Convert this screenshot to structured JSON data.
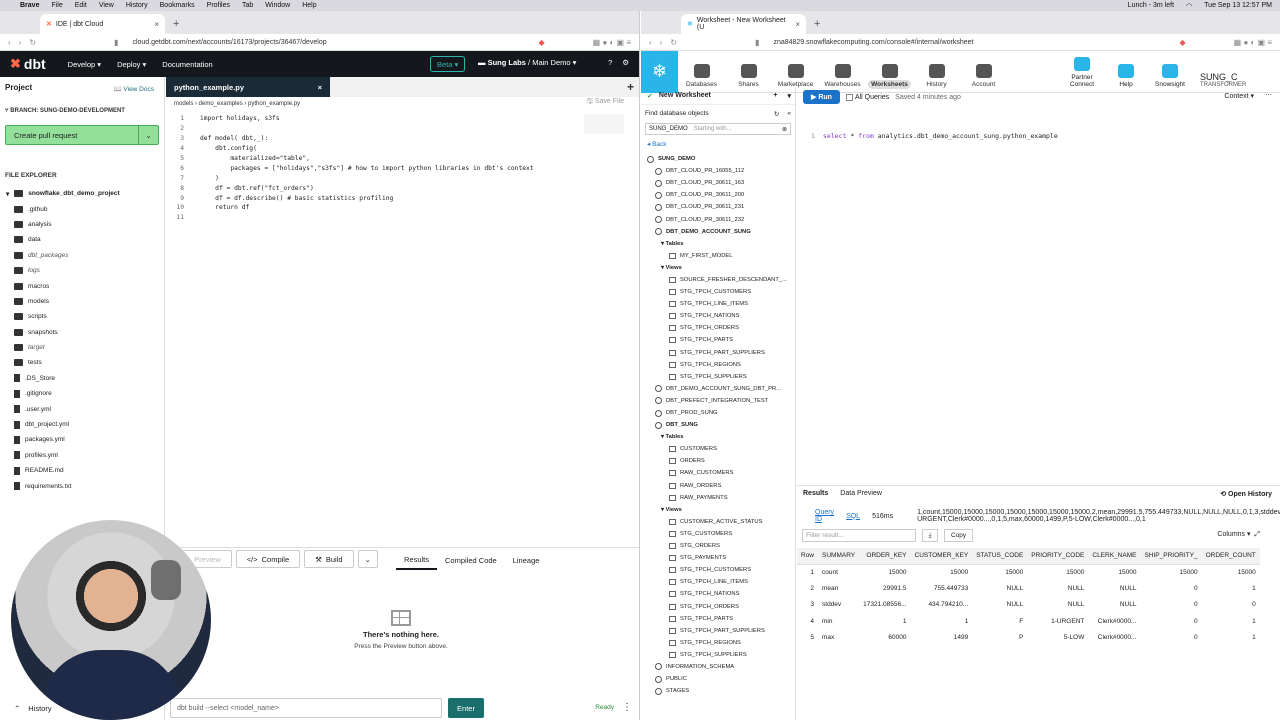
{
  "macbar": {
    "app": "Brave",
    "menus": [
      "File",
      "Edit",
      "View",
      "History",
      "Bookmarks",
      "Profiles",
      "Tab",
      "Window",
      "Help"
    ],
    "status": "Lunch - 3m left",
    "datetime": "Tue Sep 13  12:57 PM"
  },
  "left_browser": {
    "tab_title": "IDE | dbt Cloud",
    "url": "cloud.getdbt.com/next/accounts/16173/projects/36467/develop"
  },
  "dbt": {
    "logo": "dbt",
    "nav": [
      "Develop",
      "Deploy",
      "Documentation"
    ],
    "beta": "Beta",
    "project": "Sung Labs",
    "branch_sel": "Main Demo",
    "sidebar": {
      "title": "Project",
      "view_docs": "View Docs",
      "branch": "BRANCH: SUNG-DEMO-DEVELOPMENT",
      "pr_button": "Create pull request",
      "file_explorer": "FILE EXPLORER",
      "root": "snowflake_dbt_demo_project",
      "items": [
        {
          "name": ".github",
          "type": "folder"
        },
        {
          "name": "analysis",
          "type": "folder"
        },
        {
          "name": "data",
          "type": "folder"
        },
        {
          "name": "dbt_packages",
          "type": "folder",
          "italic": true
        },
        {
          "name": "logs",
          "type": "folder",
          "italic": true
        },
        {
          "name": "macros",
          "type": "folder"
        },
        {
          "name": "models",
          "type": "folder"
        },
        {
          "name": "scripts",
          "type": "folder"
        },
        {
          "name": "snapshots",
          "type": "folder"
        },
        {
          "name": "target",
          "type": "folder",
          "italic": true
        },
        {
          "name": "tests",
          "type": "folder"
        },
        {
          "name": ".DS_Store",
          "type": "file"
        },
        {
          "name": ".gitignore",
          "type": "file"
        },
        {
          "name": ".user.yml",
          "type": "file"
        },
        {
          "name": "dbt_project.yml",
          "type": "file"
        },
        {
          "name": "packages.yml",
          "type": "file"
        },
        {
          "name": "profiles.yml",
          "type": "file"
        },
        {
          "name": "README.md",
          "type": "file"
        },
        {
          "name": "requirements.txt",
          "type": "file"
        }
      ],
      "history": "History"
    },
    "editor": {
      "tab": "python_example.py",
      "breadcrumb": "models  ›  demo_examples  ›  python_example.py",
      "save": "Save File",
      "lines": [
        "import holidays, s3fs",
        "",
        "def model( dbt,_):",
        "    dbt.config(",
        "        materialized=\"table\",",
        "        packages = [\"holidays\",\"s3fs\"] # how to import python libraries in dbt's context",
        "    )",
        "    df = dbt.ref(\"fct_orders\")",
        "    df = df.describe() # basic statistics profiling",
        "    return df",
        ""
      ]
    },
    "panel": {
      "preview": "Preview",
      "compile": "Compile",
      "build": "Build",
      "tabs": [
        "Results",
        "Compiled Code",
        "Lineage"
      ],
      "empty_title": "There's nothing here.",
      "empty_sub": "Press the Preview button above."
    },
    "cmd": {
      "placeholder": "dbt build --select <model_name>",
      "enter": "Enter",
      "status": "Ready"
    }
  },
  "right_browser": {
    "tab_title": "Worksheet - New Worksheet (U",
    "url": "zna84829.snowflakecomputing.com/console#/internal/worksheet"
  },
  "snowflake": {
    "nav": [
      "Databases",
      "Shares",
      "Marketplace",
      "Warehouses",
      "Worksheets",
      "History",
      "Account"
    ],
    "right_nav": [
      "Partner Connect",
      "Help",
      "Snowsight"
    ],
    "user": "SUNG_C",
    "role": "TRANSFORMER",
    "worksheet_tab": "New Worksheet",
    "find": "Find database objects",
    "schema": "SUNG_DEMO",
    "search_ph": "Starting with...",
    "back": "Back",
    "tree": [
      {
        "t": "SUNG_DEMO",
        "lvl": "l1",
        "b": true,
        "ic": "db"
      },
      {
        "t": "DBT_CLOUD_PR_16055_112",
        "lvl": "l2",
        "ic": "db"
      },
      {
        "t": "DBT_CLOUD_PR_30611_163",
        "lvl": "l2",
        "ic": "db"
      },
      {
        "t": "DBT_CLOUD_PR_30611_200",
        "lvl": "l2",
        "ic": "db"
      },
      {
        "t": "DBT_CLOUD_PR_30611_231",
        "lvl": "l2",
        "ic": "db"
      },
      {
        "t": "DBT_CLOUD_PR_30611_232",
        "lvl": "l2",
        "ic": "db"
      },
      {
        "t": "DBT_DEMO_ACCOUNT_SUNG",
        "lvl": "l2",
        "b": true,
        "ic": "db"
      },
      {
        "t": "▾ Tables",
        "lvl": "l3"
      },
      {
        "t": "MY_FIRST_MODEL",
        "lvl": "l4",
        "ic": "tb"
      },
      {
        "t": "▾ Views",
        "lvl": "l3"
      },
      {
        "t": "SOURCE_FRESHER_DESCENDANT_...",
        "lvl": "l4",
        "ic": "tb"
      },
      {
        "t": "STG_TPCH_CUSTOMERS",
        "lvl": "l4",
        "ic": "tb"
      },
      {
        "t": "STG_TPCH_LINE_ITEMS",
        "lvl": "l4",
        "ic": "tb"
      },
      {
        "t": "STG_TPCH_NATIONS",
        "lvl": "l4",
        "ic": "tb"
      },
      {
        "t": "STG_TPCH_ORDERS",
        "lvl": "l4",
        "ic": "tb"
      },
      {
        "t": "STG_TPCH_PARTS",
        "lvl": "l4",
        "ic": "tb"
      },
      {
        "t": "STG_TPCH_PART_SUPPLIERS",
        "lvl": "l4",
        "ic": "tb"
      },
      {
        "t": "STG_TPCH_REGIONS",
        "lvl": "l4",
        "ic": "tb"
      },
      {
        "t": "STG_TPCH_SUPPLIERS",
        "lvl": "l4",
        "ic": "tb"
      },
      {
        "t": "DBT_DEMO_ACCOUNT_SUNG_DBT_PR...",
        "lvl": "l2",
        "ic": "db"
      },
      {
        "t": "DBT_PREFECT_INTEGRATION_TEST",
        "lvl": "l2",
        "ic": "db"
      },
      {
        "t": "DBT_PROD_SUNG",
        "lvl": "l2",
        "ic": "db"
      },
      {
        "t": "DBT_SUNG",
        "lvl": "l2",
        "b": true,
        "ic": "db"
      },
      {
        "t": "▾ Tables",
        "lvl": "l3"
      },
      {
        "t": "CUSTOMERS",
        "lvl": "l4",
        "ic": "tb"
      },
      {
        "t": "ORDERS",
        "lvl": "l4",
        "ic": "tb"
      },
      {
        "t": "RAW_CUSTOMERS",
        "lvl": "l4",
        "ic": "tb"
      },
      {
        "t": "RAW_ORDERS",
        "lvl": "l4",
        "ic": "tb"
      },
      {
        "t": "RAW_PAYMENTS",
        "lvl": "l4",
        "ic": "tb"
      },
      {
        "t": "▾ Views",
        "lvl": "l3"
      },
      {
        "t": "CUSTOMER_ACTIVE_STATUS",
        "lvl": "l4",
        "ic": "tb"
      },
      {
        "t": "STG_CUSTOMERS",
        "lvl": "l4",
        "ic": "tb"
      },
      {
        "t": "STG_ORDERS",
        "lvl": "l4",
        "ic": "tb"
      },
      {
        "t": "STG_PAYMENTS",
        "lvl": "l4",
        "ic": "tb"
      },
      {
        "t": "STG_TPCH_CUSTOMERS",
        "lvl": "l4",
        "ic": "tb"
      },
      {
        "t": "STG_TPCH_LINE_ITEMS",
        "lvl": "l4",
        "ic": "tb"
      },
      {
        "t": "STG_TPCH_NATIONS",
        "lvl": "l4",
        "ic": "tb"
      },
      {
        "t": "STG_TPCH_ORDERS",
        "lvl": "l4",
        "ic": "tb"
      },
      {
        "t": "STG_TPCH_PARTS",
        "lvl": "l4",
        "ic": "tb"
      },
      {
        "t": "STG_TPCH_PART_SUPPLIERS",
        "lvl": "l4",
        "ic": "tb"
      },
      {
        "t": "STG_TPCH_REGIONS",
        "lvl": "l4",
        "ic": "tb"
      },
      {
        "t": "STG_TPCH_SUPPLIERS",
        "lvl": "l4",
        "ic": "tb"
      },
      {
        "t": "INFORMATION_SCHEMA",
        "lvl": "l2",
        "ic": "db"
      },
      {
        "t": "PUBLIC",
        "lvl": "l2",
        "ic": "db"
      },
      {
        "t": "STAGES",
        "lvl": "l2",
        "ic": "db"
      }
    ],
    "run": "Run",
    "all_queries": "All Queries",
    "saved": "Saved 4 minutes ago",
    "context": "Context",
    "sql": {
      "kw1": "select",
      "rest": " * ",
      "kw2": "from",
      "table": " analytics.dbt_demo_account_sung.python_example"
    },
    "results": {
      "tabs": [
        "Results",
        "Data Preview"
      ],
      "open_history": "Open History",
      "query_id": "Query ID",
      "sql": "SQL",
      "time": "516ms",
      "rows": [
        [
          "1",
          "count",
          "15000",
          "15000",
          "15000",
          "15000",
          "15000",
          "15000",
          "15000"
        ],
        [
          "2",
          "mean",
          "29991.5",
          "755.449733",
          "NULL",
          "NULL",
          "NULL",
          "0",
          "1"
        ],
        [
          "3",
          "stddev",
          "17321.08556...",
          "434.794210...",
          "NULL",
          "NULL",
          "NULL",
          "0",
          "0"
        ],
        [
          "4",
          "min",
          "1",
          "1",
          "F",
          "1-URGENT",
          "Clerk#0000...",
          "0",
          "1"
        ],
        [
          "5",
          "max",
          "60000",
          "1499",
          "P",
          "5-LOW",
          "Clerk#0000...",
          "0",
          "1"
        ]
      ],
      "filter": "Filter result...",
      "copy": "Copy",
      "columns": "Columns",
      "headers": [
        "Row",
        "SUMMARY",
        "ORDER_KEY",
        "CUSTOMER_KEY",
        "STATUS_CODE",
        "PRIORITY_CODE",
        "CLERK_NAME",
        "SHIP_PRIORITY_",
        "ORDER_COUNT"
      ]
    }
  }
}
